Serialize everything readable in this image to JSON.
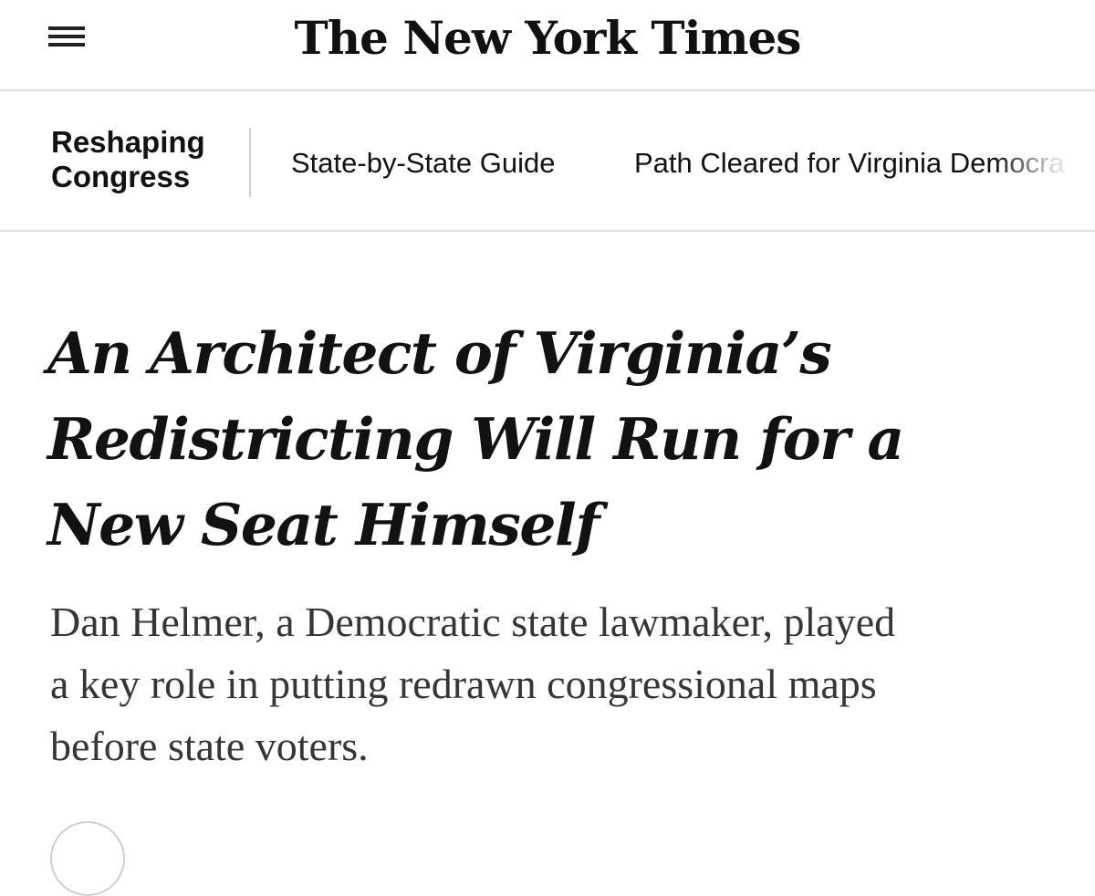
{
  "header": {
    "logo_text": "The New York Times",
    "menu_icon": "hamburger-menu-icon"
  },
  "section_nav": {
    "section_title_line1": "Reshaping",
    "section_title_line2": "Congress",
    "links": [
      {
        "label": "State-by-State Guide"
      },
      {
        "label": "Path Cleared for Virginia Democra"
      }
    ]
  },
  "article": {
    "headline_line1": "An Architect of Virginia’s",
    "headline_line2": "Redistricting Will Run for a",
    "headline_line3": "New Seat Himself",
    "summary_line1": "Dan Helmer, a Democratic state lawmaker, played",
    "summary_line2": "a key role in putting redrawn congressional maps",
    "summary_line3": "before state voters."
  }
}
